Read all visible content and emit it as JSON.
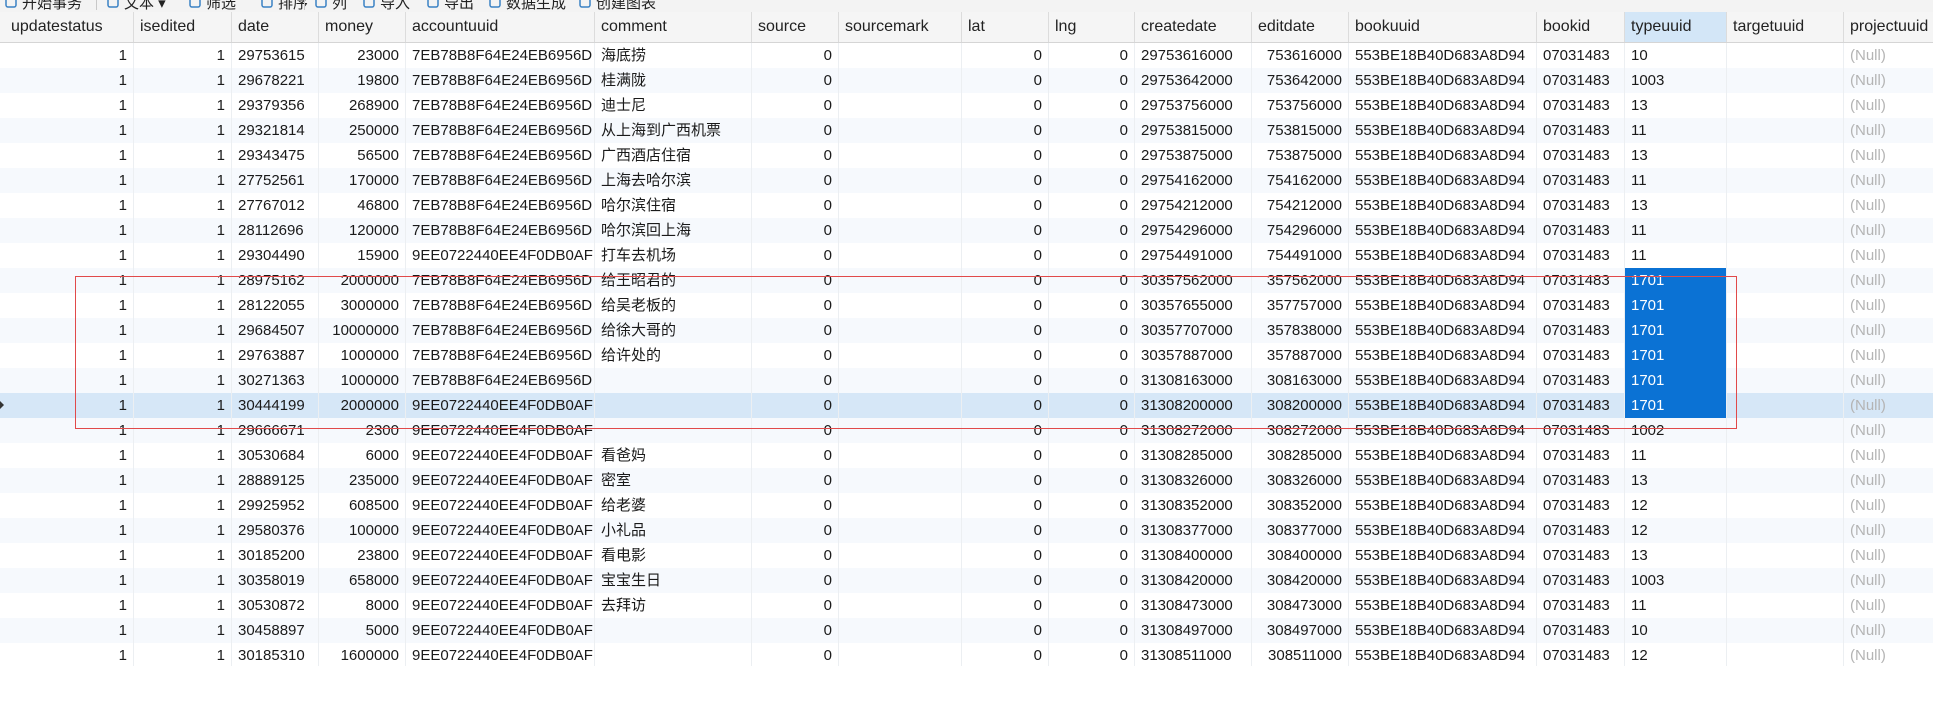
{
  "toolbar": {
    "items": [
      {
        "label": "开始事务",
        "icon": "begin-transaction-icon"
      },
      {
        "label": "文本 ▾",
        "icon": "text-icon"
      },
      {
        "label": "筛选",
        "icon": "filter-icon"
      },
      {
        "label": "排序",
        "icon": "sort-icon"
      },
      {
        "label": "列",
        "icon": "columns-icon"
      },
      {
        "label": "导入",
        "icon": "import-icon"
      },
      {
        "label": "导出",
        "icon": "export-icon"
      },
      {
        "label": "数据生成",
        "icon": "data-generate-icon"
      },
      {
        "label": "创建图表",
        "icon": "create-chart-icon"
      }
    ]
  },
  "table": {
    "columns": [
      "updatestatus",
      "isedited",
      "date",
      "money",
      "accountuuid",
      "comment",
      "source",
      "sourcemark",
      "lat",
      "lng",
      "createdate",
      "editdate",
      "bookuuid",
      "bookid",
      "typeuuid",
      "targetuuid",
      "projectuuid"
    ],
    "active_column": "typeuuid",
    "null_text": "(Null)",
    "rows": [
      [
        "1",
        "1",
        "29753615",
        "23000",
        "7EB78B8F64E24EB6956D",
        "海底捞",
        "0",
        "",
        "0",
        "0",
        "29753616000",
        "753616000",
        "553BE18B40D683A8D94",
        "07031483",
        "10",
        "",
        "(Null)"
      ],
      [
        "1",
        "1",
        "29678221",
        "19800",
        "7EB78B8F64E24EB6956D",
        "桂满陇",
        "0",
        "",
        "0",
        "0",
        "29753642000",
        "753642000",
        "553BE18B40D683A8D94",
        "07031483",
        "1003",
        "",
        "(Null)"
      ],
      [
        "1",
        "1",
        "29379356",
        "268900",
        "7EB78B8F64E24EB6956D",
        "迪士尼",
        "0",
        "",
        "0",
        "0",
        "29753756000",
        "753756000",
        "553BE18B40D683A8D94",
        "07031483",
        "13",
        "",
        "(Null)"
      ],
      [
        "1",
        "1",
        "29321814",
        "250000",
        "7EB78B8F64E24EB6956D",
        "从上海到广西机票",
        "0",
        "",
        "0",
        "0",
        "29753815000",
        "753815000",
        "553BE18B40D683A8D94",
        "07031483",
        "11",
        "",
        "(Null)"
      ],
      [
        "1",
        "1",
        "29343475",
        "56500",
        "7EB78B8F64E24EB6956D",
        "广西酒店住宿",
        "0",
        "",
        "0",
        "0",
        "29753875000",
        "753875000",
        "553BE18B40D683A8D94",
        "07031483",
        "13",
        "",
        "(Null)"
      ],
      [
        "1",
        "1",
        "27752561",
        "170000",
        "7EB78B8F64E24EB6956D",
        "上海去哈尔滨",
        "0",
        "",
        "0",
        "0",
        "29754162000",
        "754162000",
        "553BE18B40D683A8D94",
        "07031483",
        "11",
        "",
        "(Null)"
      ],
      [
        "1",
        "1",
        "27767012",
        "46800",
        "7EB78B8F64E24EB6956D",
        "哈尔滨住宿",
        "0",
        "",
        "0",
        "0",
        "29754212000",
        "754212000",
        "553BE18B40D683A8D94",
        "07031483",
        "13",
        "",
        "(Null)"
      ],
      [
        "1",
        "1",
        "28112696",
        "120000",
        "7EB78B8F64E24EB6956D",
        "哈尔滨回上海",
        "0",
        "",
        "0",
        "0",
        "29754296000",
        "754296000",
        "553BE18B40D683A8D94",
        "07031483",
        "11",
        "",
        "(Null)"
      ],
      [
        "1",
        "1",
        "29304490",
        "15900",
        "9EE0722440EE4F0DB0AF",
        "打车去机场",
        "0",
        "",
        "0",
        "0",
        "29754491000",
        "754491000",
        "553BE18B40D683A8D94",
        "07031483",
        "11",
        "",
        "(Null)"
      ],
      [
        "1",
        "1",
        "28975162",
        "2000000",
        "7EB78B8F64E24EB6956D",
        "给王昭君的",
        "0",
        "",
        "0",
        "0",
        "30357562000",
        "357562000",
        "553BE18B40D683A8D94",
        "07031483",
        "1701",
        "",
        "(Null)"
      ],
      [
        "1",
        "1",
        "28122055",
        "3000000",
        "7EB78B8F64E24EB6956D",
        "给吴老板的",
        "0",
        "",
        "0",
        "0",
        "30357655000",
        "357757000",
        "553BE18B40D683A8D94",
        "07031483",
        "1701",
        "",
        "(Null)"
      ],
      [
        "1",
        "1",
        "29684507",
        "10000000",
        "7EB78B8F64E24EB6956D",
        "给徐大哥的",
        "0",
        "",
        "0",
        "0",
        "30357707000",
        "357838000",
        "553BE18B40D683A8D94",
        "07031483",
        "1701",
        "",
        "(Null)"
      ],
      [
        "1",
        "1",
        "29763887",
        "1000000",
        "7EB78B8F64E24EB6956D",
        "给许处的",
        "0",
        "",
        "0",
        "0",
        "30357887000",
        "357887000",
        "553BE18B40D683A8D94",
        "07031483",
        "1701",
        "",
        "(Null)"
      ],
      [
        "1",
        "1",
        "30271363",
        "1000000",
        "7EB78B8F64E24EB6956D",
        "",
        "0",
        "",
        "0",
        "0",
        "31308163000",
        "308163000",
        "553BE18B40D683A8D94",
        "07031483",
        "1701",
        "",
        "(Null)"
      ],
      [
        "1",
        "1",
        "30444199",
        "2000000",
        "9EE0722440EE4F0DB0AF",
        "",
        "0",
        "",
        "0",
        "0",
        "31308200000",
        "308200000",
        "553BE18B40D683A8D94",
        "07031483",
        "1701",
        "",
        "(Null)"
      ],
      [
        "1",
        "1",
        "29666671",
        "2300",
        "9EE0722440EE4F0DB0AF",
        "",
        "0",
        "",
        "0",
        "0",
        "31308272000",
        "308272000",
        "553BE18B40D683A8D94",
        "07031483",
        "1002",
        "",
        "(Null)"
      ],
      [
        "1",
        "1",
        "30530684",
        "6000",
        "9EE0722440EE4F0DB0AF",
        "看爸妈",
        "0",
        "",
        "0",
        "0",
        "31308285000",
        "308285000",
        "553BE18B40D683A8D94",
        "07031483",
        "11",
        "",
        "(Null)"
      ],
      [
        "1",
        "1",
        "28889125",
        "235000",
        "9EE0722440EE4F0DB0AF",
        "密室",
        "0",
        "",
        "0",
        "0",
        "31308326000",
        "308326000",
        "553BE18B40D683A8D94",
        "07031483",
        "13",
        "",
        "(Null)"
      ],
      [
        "1",
        "1",
        "29925952",
        "608500",
        "9EE0722440EE4F0DB0AF",
        "给老婆",
        "0",
        "",
        "0",
        "0",
        "31308352000",
        "308352000",
        "553BE18B40D683A8D94",
        "07031483",
        "12",
        "",
        "(Null)"
      ],
      [
        "1",
        "1",
        "29580376",
        "100000",
        "9EE0722440EE4F0DB0AF",
        "小礼品",
        "0",
        "",
        "0",
        "0",
        "31308377000",
        "308377000",
        "553BE18B40D683A8D94",
        "07031483",
        "12",
        "",
        "(Null)"
      ],
      [
        "1",
        "1",
        "30185200",
        "23800",
        "9EE0722440EE4F0DB0AF",
        "看电影",
        "0",
        "",
        "0",
        "0",
        "31308400000",
        "308400000",
        "553BE18B40D683A8D94",
        "07031483",
        "13",
        "",
        "(Null)"
      ],
      [
        "1",
        "1",
        "30358019",
        "658000",
        "9EE0722440EE4F0DB0AF",
        "宝宝生日",
        "0",
        "",
        "0",
        "0",
        "31308420000",
        "308420000",
        "553BE18B40D683A8D94",
        "07031483",
        "1003",
        "",
        "(Null)"
      ],
      [
        "1",
        "1",
        "30530872",
        "8000",
        "9EE0722440EE4F0DB0AF",
        "去拜访",
        "0",
        "",
        "0",
        "0",
        "31308473000",
        "308473000",
        "553BE18B40D683A8D94",
        "07031483",
        "11",
        "",
        "(Null)"
      ],
      [
        "1",
        "1",
        "30458897",
        "5000",
        "9EE0722440EE4F0DB0AF",
        "",
        "0",
        "",
        "0",
        "0",
        "31308497000",
        "308497000",
        "553BE18B40D683A8D94",
        "07031483",
        "10",
        "",
        "(Null)"
      ],
      [
        "1",
        "1",
        "30185310",
        "1600000",
        "9EE0722440EE4F0DB0AF",
        "",
        "0",
        "",
        "0",
        "0",
        "31308511000",
        "308511000",
        "553BE18B40D683A8D94",
        "07031483",
        "12",
        "",
        "(Null)"
      ]
    ],
    "selected_row": 14,
    "highlighted_rows": [
      9,
      10,
      11,
      12,
      13,
      14
    ],
    "highlight_color": "#0b72d4",
    "box_color": "#e14a4a"
  }
}
